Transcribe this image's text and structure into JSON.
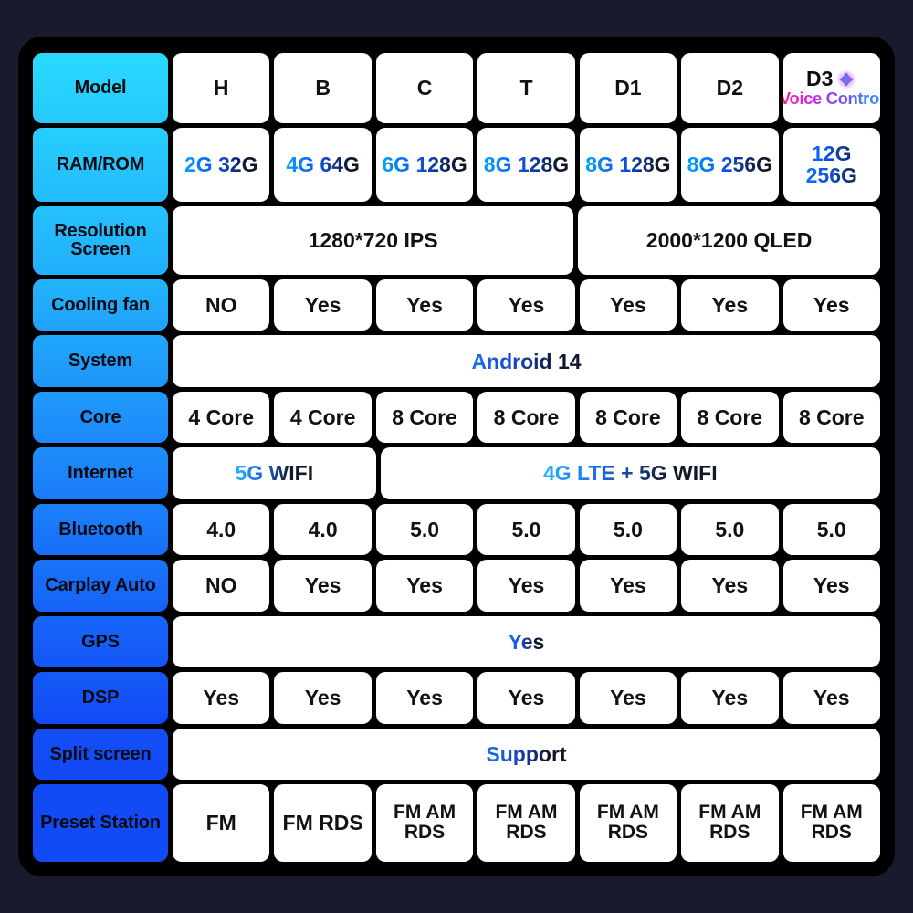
{
  "card": {
    "background": "#000000",
    "page_background": "#191a2c",
    "label_gradient_top": "#2ae4ff",
    "label_gradient_bottom": "#1550f0"
  },
  "icons": {
    "voice": "voice-sparkle-icon"
  },
  "columns": [
    "H",
    "B",
    "C",
    "T",
    "D1",
    "D2",
    "D3"
  ],
  "rows": [
    {
      "label": "Model",
      "name": "model",
      "cells": [
        {
          "text": "H",
          "span": 1
        },
        {
          "text": "B",
          "span": 1
        },
        {
          "text": "C",
          "span": 1
        },
        {
          "text": "T",
          "span": 1
        },
        {
          "text": "D1",
          "span": 1
        },
        {
          "text": "D2",
          "span": 1
        },
        {
          "text": "D3",
          "span": 1,
          "badge": "Voice Control"
        }
      ]
    },
    {
      "label": "RAM/ROM",
      "name": "ram-rom",
      "style": "grad",
      "cells": [
        {
          "text": "2G 32G",
          "span": 1
        },
        {
          "text": "4G 64G",
          "span": 1
        },
        {
          "text": "6G 128G",
          "span": 1
        },
        {
          "text": "8G 128G",
          "span": 1
        },
        {
          "text": "8G 128G",
          "span": 1
        },
        {
          "text": "8G 256G",
          "span": 1
        },
        {
          "text": "12G 256G",
          "span": 1
        }
      ]
    },
    {
      "label": "Resolution\nScreen",
      "name": "resolution-screen",
      "cells": [
        {
          "text": "1280*720 IPS",
          "span": 4
        },
        {
          "text": "2000*1200 QLED",
          "span": 3
        }
      ]
    },
    {
      "label": "Cooling fan",
      "name": "cooling-fan",
      "cells": [
        {
          "text": "NO",
          "span": 1
        },
        {
          "text": "Yes",
          "span": 1
        },
        {
          "text": "Yes",
          "span": 1
        },
        {
          "text": "Yes",
          "span": 1
        },
        {
          "text": "Yes",
          "span": 1
        },
        {
          "text": "Yes",
          "span": 1
        },
        {
          "text": "Yes",
          "span": 1
        }
      ]
    },
    {
      "label": "System",
      "name": "system",
      "style": "grad-wide",
      "cells": [
        {
          "text": "Android 14",
          "span": 7
        }
      ]
    },
    {
      "label": "Core",
      "name": "core",
      "cells": [
        {
          "text": "4 Core",
          "span": 1
        },
        {
          "text": "4 Core",
          "span": 1
        },
        {
          "text": "8 Core",
          "span": 1
        },
        {
          "text": "8 Core",
          "span": 1
        },
        {
          "text": "8 Core",
          "span": 1
        },
        {
          "text": "8 Core",
          "span": 1
        },
        {
          "text": "8 Core",
          "span": 1
        }
      ]
    },
    {
      "label": "Internet",
      "name": "internet",
      "style": "grad-net",
      "cells": [
        {
          "text": "5G WIFI",
          "span": 2
        },
        {
          "text": "4G LTE + 5G WIFI",
          "span": 5
        }
      ]
    },
    {
      "label": "Bluetooth",
      "name": "bluetooth",
      "cells": [
        {
          "text": "4.0",
          "span": 1
        },
        {
          "text": "4.0",
          "span": 1
        },
        {
          "text": "5.0",
          "span": 1
        },
        {
          "text": "5.0",
          "span": 1
        },
        {
          "text": "5.0",
          "span": 1
        },
        {
          "text": "5.0",
          "span": 1
        },
        {
          "text": "5.0",
          "span": 1
        }
      ]
    },
    {
      "label": "Carplay Auto",
      "name": "carplay-auto",
      "cells": [
        {
          "text": "NO",
          "span": 1
        },
        {
          "text": "Yes",
          "span": 1
        },
        {
          "text": "Yes",
          "span": 1
        },
        {
          "text": "Yes",
          "span": 1
        },
        {
          "text": "Yes",
          "span": 1
        },
        {
          "text": "Yes",
          "span": 1
        },
        {
          "text": "Yes",
          "span": 1
        }
      ]
    },
    {
      "label": "GPS",
      "name": "gps",
      "style": "grad-wide",
      "cells": [
        {
          "text": "Yes",
          "span": 7
        }
      ]
    },
    {
      "label": "DSP",
      "name": "dsp",
      "cells": [
        {
          "text": "Yes",
          "span": 1
        },
        {
          "text": "Yes",
          "span": 1
        },
        {
          "text": "Yes",
          "span": 1
        },
        {
          "text": "Yes",
          "span": 1
        },
        {
          "text": "Yes",
          "span": 1
        },
        {
          "text": "Yes",
          "span": 1
        },
        {
          "text": "Yes",
          "span": 1
        }
      ]
    },
    {
      "label": "Split screen",
      "name": "split-screen",
      "style": "grad-wide",
      "cells": [
        {
          "text": "Support",
          "span": 7
        }
      ]
    },
    {
      "label": "Preset Station",
      "name": "preset-station",
      "cells": [
        {
          "text": "FM",
          "span": 1
        },
        {
          "text": "FM RDS",
          "span": 1
        },
        {
          "text": "FM AM\nRDS",
          "span": 1
        },
        {
          "text": "FM AM\nRDS",
          "span": 1
        },
        {
          "text": "FM AM\nRDS",
          "span": 1
        },
        {
          "text": "FM AM\nRDS",
          "span": 1
        },
        {
          "text": "FM AM\nRDS",
          "span": 1
        }
      ]
    }
  ]
}
